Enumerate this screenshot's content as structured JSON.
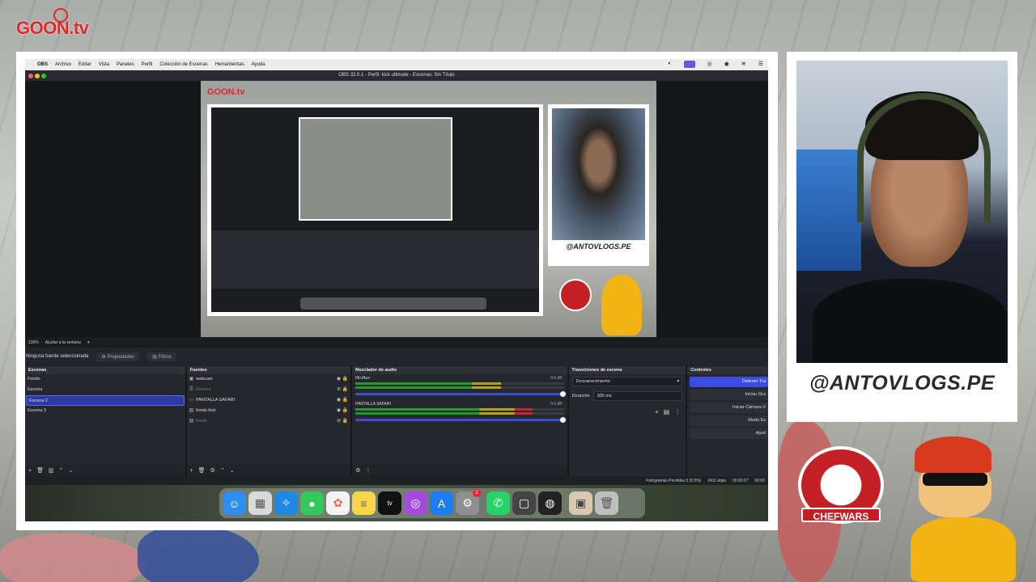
{
  "background": {
    "brand_logo": "GOON.tv",
    "brand_color": "#e3262b"
  },
  "macos_menubar": {
    "items": [
      "OBS",
      "Archivo",
      "Editar",
      "Vista",
      "Paneles",
      "Perfil",
      "Colección de Escenas",
      "Herramientas",
      "Ayuda"
    ]
  },
  "obs": {
    "window_title": "OBS 32.0.1 - Perfil: kick ultimate - Escenas: Sin Título",
    "zoom": "130%",
    "zoom_mode": "Ajustar a la ventana",
    "source_status": "Ninguna fuente seleccionada",
    "properties_label": "Propiedades",
    "filters_label": "Filtros",
    "scenes": {
      "title": "Escenas",
      "items": [
        "Fondo",
        "Escena",
        "Escena 2",
        "Escena 3"
      ],
      "selected": "Escena 2"
    },
    "sources": {
      "title": "Fuentes",
      "items": [
        {
          "name": "webcam",
          "icon": "camera-icon",
          "visible": true
        },
        {
          "name": "Escena",
          "icon": "list-icon",
          "visible": false
        },
        {
          "name": "PANTALLA SAFARI",
          "icon": "monitor-icon",
          "visible": true
        },
        {
          "name": "fondo kick",
          "icon": "image-icon",
          "visible": true
        },
        {
          "name": "fondo",
          "icon": "image-icon",
          "visible": false
        }
      ]
    },
    "audio_mixer": {
      "title": "Mezclador de audio",
      "tracks": [
        {
          "name": "Mic/Aux",
          "db": "0.0 dB",
          "level": 0.7
        },
        {
          "name": "PANTALLA SAFARI",
          "db": "0.0 dB",
          "level": 0.85
        }
      ]
    },
    "transitions": {
      "title": "Transiciones de escena",
      "type": "Desvanecimiento",
      "duration_label": "Duración",
      "duration": "300 ms"
    },
    "controls": {
      "title": "Controles",
      "buttons": [
        "Detener Tra",
        "Iniciar Gra",
        "Iniciar Cámara V",
        "Modo Es",
        "Ajust"
      ]
    },
    "status": {
      "dropped_frames": "Fotogramas Perdidos 0 (0.0%)",
      "bitrate": "2411 kbps",
      "stream_time": "00:00:07",
      "record_time": "00:00"
    }
  },
  "dock": {
    "apps": [
      {
        "icon": "finder-icon",
        "color": "#2f8ff0"
      },
      {
        "icon": "launchpad-icon",
        "color": "#e6e6e6"
      },
      {
        "icon": "safari-icon",
        "color": "#1e88e5"
      },
      {
        "icon": "messages-icon",
        "color": "#34c759"
      },
      {
        "icon": "photos-icon",
        "color": "#f4f4f4"
      },
      {
        "icon": "notes-icon",
        "color": "#f7d64a"
      },
      {
        "icon": "appletv-icon",
        "color": "#111111"
      },
      {
        "icon": "podcasts-icon",
        "color": "#a54ce0"
      },
      {
        "icon": "appstore-icon",
        "color": "#1c7cf2"
      },
      {
        "icon": "settings-icon",
        "color": "#8e8e93"
      },
      {
        "icon": "whatsapp-icon",
        "color": "#25d366"
      },
      {
        "icon": "window-icon",
        "color": "#444444"
      },
      {
        "icon": "obs-icon",
        "color": "#222222"
      },
      {
        "icon": "preview-icon",
        "color": "#d9c7b0"
      },
      {
        "icon": "trash-icon",
        "color": "#bfbfbf"
      }
    ],
    "settings_badge": "2"
  },
  "overlay": {
    "handle": "@ANTOVLOGS.PE",
    "chef_logo": "CHEFWARS"
  }
}
